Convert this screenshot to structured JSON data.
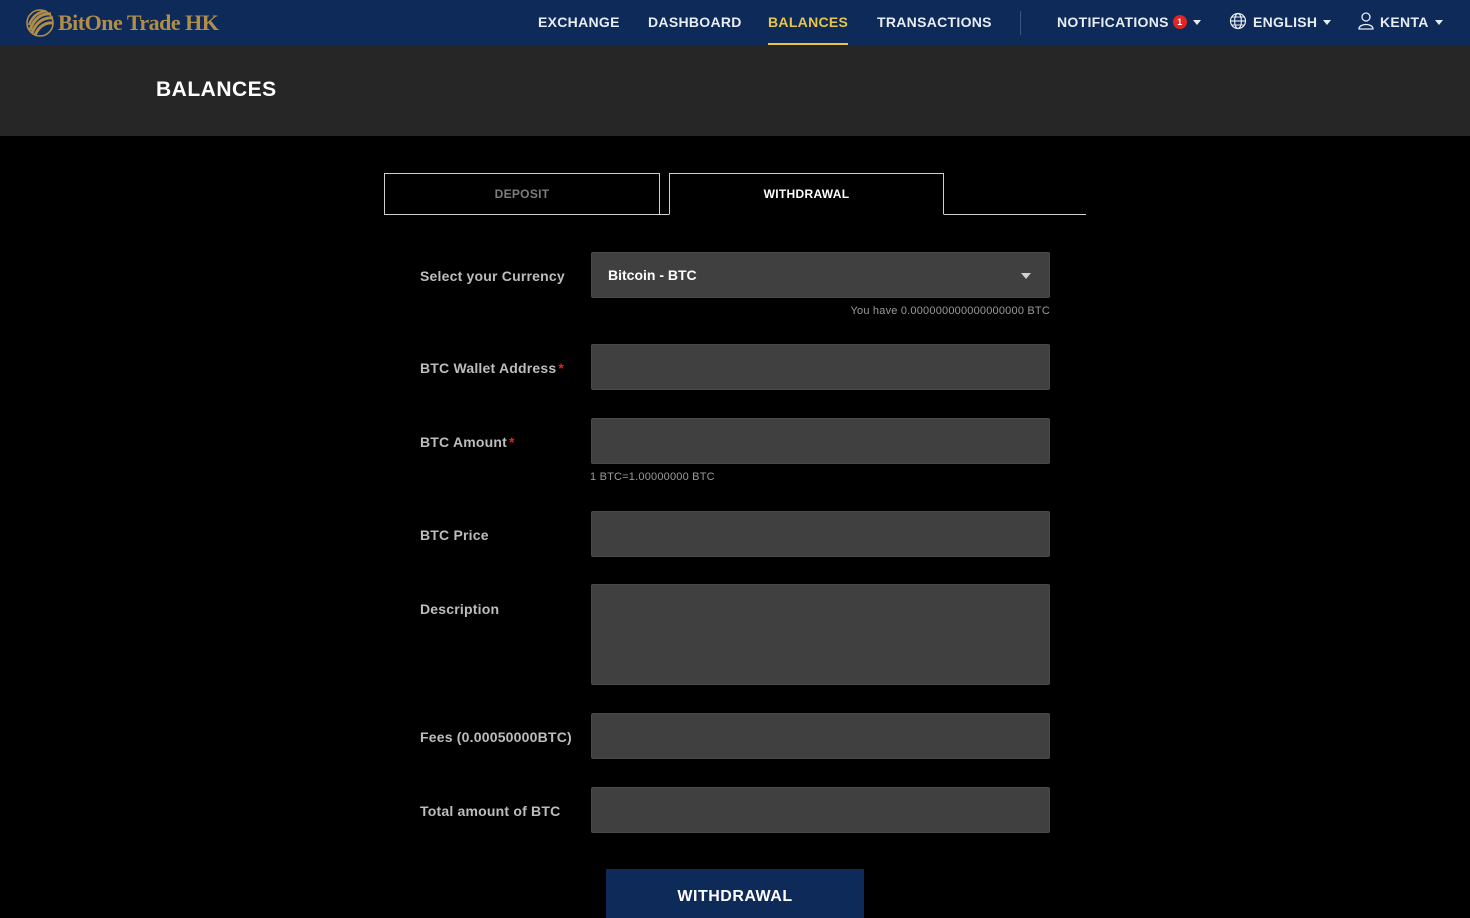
{
  "brand": {
    "name": "BitOne Trade HK"
  },
  "nav": {
    "exchange": "EXCHANGE",
    "dashboard": "DASHBOARD",
    "balances": "BALANCES",
    "transactions": "TRANSACTIONS",
    "notifications": "NOTIFICATIONS",
    "notification_count": "1",
    "language": "ENGLISH",
    "user": "KENTA"
  },
  "page": {
    "title": "BALANCES"
  },
  "tabs": {
    "deposit": "DEPOSIT",
    "withdrawal": "WITHDRAWAL",
    "active": "withdrawal"
  },
  "form": {
    "currency_label": "Select your Currency",
    "currency_value": "Bitcoin - BTC",
    "balance_hint": "You have 0.000000000000000000 BTC",
    "wallet_label": "BTC Wallet Address",
    "wallet_value": "",
    "amount_label": "BTC Amount",
    "amount_value": "",
    "rate_hint": "1 BTC=1.00000000 BTC",
    "price_label": "BTC Price",
    "price_value": "",
    "description_label": "Description",
    "description_value": "",
    "fees_label": "Fees (0.00050000BTC)",
    "fees_value": "",
    "total_label": "Total amount of BTC",
    "total_value": "",
    "required_mark": "*",
    "submit_label": "WITHDRAWAL"
  },
  "colors": {
    "nav_bg": "#0d2a59",
    "active_nav": "#e8c547",
    "brand_gold": "#b08d48",
    "badge": "#e02424",
    "field_bg": "#404040"
  }
}
